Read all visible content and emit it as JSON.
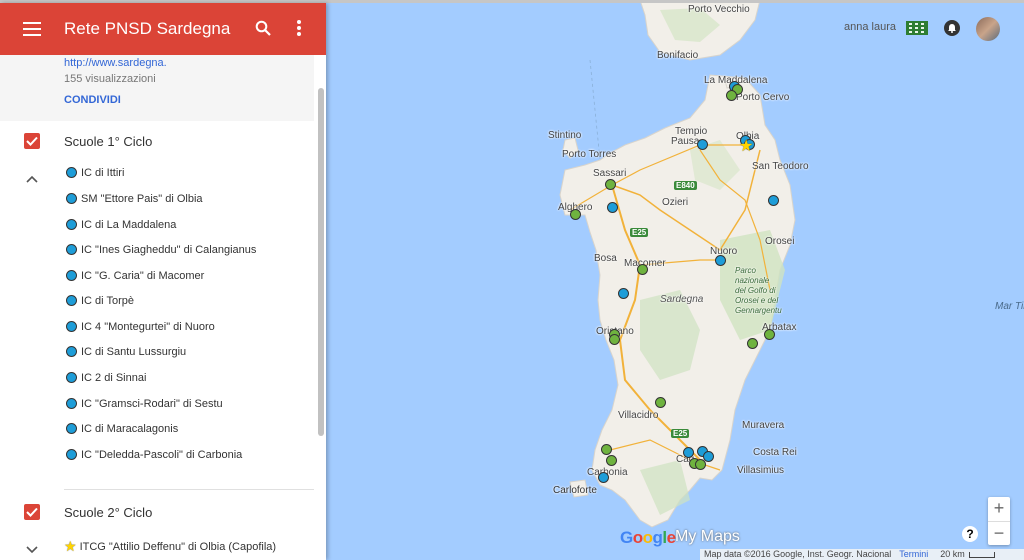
{
  "panel": {
    "app_title": "Rete PNSD Sardegna",
    "info": {
      "link": "http://www.sardegna.",
      "views": "155 visualizzazioni",
      "share": "CONDIVIDI"
    },
    "layers": [
      {
        "title": "Scuole 1° Ciclo",
        "checked": true,
        "expanded": true,
        "items": [
          {
            "label": "IC di Ittiri",
            "icon": "blue-circle"
          },
          {
            "label": "SM \"Ettore Pais\" di Olbia",
            "icon": "blue-circle"
          },
          {
            "label": "IC di La Maddalena",
            "icon": "blue-circle"
          },
          {
            "label": "IC \"Ines Giagheddu\" di Calangianus",
            "icon": "blue-circle"
          },
          {
            "label": "IC \"G. Caria\" di Macomer",
            "icon": "blue-circle"
          },
          {
            "label": "IC di Torpè",
            "icon": "blue-circle"
          },
          {
            "label": "IC 4 \"Montegurtei\" di Nuoro",
            "icon": "blue-circle"
          },
          {
            "label": "IC di Santu Lussurgiu",
            "icon": "blue-circle"
          },
          {
            "label": "IC 2 di Sinnai",
            "icon": "blue-circle"
          },
          {
            "label": "IC \"Gramsci-Rodari\" di Sestu",
            "icon": "blue-circle"
          },
          {
            "label": "IC di Maracalagonis",
            "icon": "blue-circle"
          },
          {
            "label": "IC \"Deledda-Pascoli\" di Carbonia",
            "icon": "blue-circle"
          }
        ]
      },
      {
        "title": "Scuole 2° Ciclo",
        "checked": true,
        "expanded": true,
        "items": [
          {
            "label": "ITCG \"Attilio Deffenu\" di Olbia (Capofila)",
            "icon": "yellow-star"
          }
        ]
      }
    ]
  },
  "header": {
    "user_name": "anna laura"
  },
  "map": {
    "labels": {
      "porto_vecchio": "Porto Vecchio",
      "bonifacio": "Bonifacio",
      "la_maddalena": "La Maddalena",
      "porto_cervo": "Porto Cervo",
      "stintino": "Stintino",
      "tempio": "Tempio",
      "pausania": "Pausa",
      "olbia": "Olbia",
      "porto_torres": "Porto Torres",
      "san_teodoro": "San Teodoro",
      "sassari": "Sassari",
      "alghero": "Alghero",
      "ozieri": "Ozieri",
      "nuoro": "Nuoro",
      "orosei": "Orosei",
      "bosa": "Bosa",
      "macomer": "Macomer",
      "parco": "Parco\nnazionale\ndel Golfo di\nOrosei e del\nGennargentu",
      "sardegna": "Sardegna",
      "mar_tirreno": "Mar Tir",
      "arbatax": "Arbatax",
      "oristano": "Oristano",
      "villacidro": "Villacidro",
      "muravera": "Muravera",
      "cagliari": "Cag",
      "carbonia": "Carbonia",
      "villasimius": "Villasimius",
      "costa_rei": "Costa Rei",
      "carloforte": "Carloforte",
      "e840": "E840",
      "e25_north": "E25",
      "e25_south": "E25"
    },
    "markers": [
      {
        "type": "blue",
        "place": "La Maddalena"
      },
      {
        "type": "green",
        "place": "La Maddalena"
      },
      {
        "type": "green",
        "place": "La Maddalena"
      },
      {
        "type": "blue",
        "place": "Tempio Pausania"
      },
      {
        "type": "blue",
        "place": "Olbia"
      },
      {
        "type": "blue",
        "place": "Olbia"
      },
      {
        "type": "star",
        "place": "Olbia"
      },
      {
        "type": "green",
        "place": "Sassari"
      },
      {
        "type": "blue",
        "place": "Ittiri"
      },
      {
        "type": "green",
        "place": "Alghero"
      },
      {
        "type": "blue",
        "place": "Torpè"
      },
      {
        "type": "blue",
        "place": "Nuoro"
      },
      {
        "type": "green",
        "place": "Macomer"
      },
      {
        "type": "blue",
        "place": "Santu Lussurgiu"
      },
      {
        "type": "green",
        "place": "Oristano"
      },
      {
        "type": "green",
        "place": "Oristano"
      },
      {
        "type": "green",
        "place": "Arbatax"
      },
      {
        "type": "green",
        "place": "Tortolì"
      },
      {
        "type": "green",
        "place": "Villacidro"
      },
      {
        "type": "green",
        "place": "Iglesias"
      },
      {
        "type": "green",
        "place": "Iglesias"
      },
      {
        "type": "blue",
        "place": "Carbonia"
      },
      {
        "type": "blue",
        "place": "Cagliari"
      },
      {
        "type": "blue",
        "place": "Cagliari"
      },
      {
        "type": "blue",
        "place": "Cagliari"
      },
      {
        "type": "green",
        "place": "Cagliari"
      },
      {
        "type": "green",
        "place": "Cagliari"
      }
    ],
    "footer": {
      "map_data": "Map data ©2016 Google, Inst. Geogr. Nacional",
      "terms": "Termini",
      "scale": "20 km"
    },
    "logo_google": "Google",
    "logo_mymaps": "My Maps",
    "zoom_in": "+",
    "zoom_out": "−",
    "help": "?"
  },
  "colors": {
    "header_red": "#db4437",
    "sea": "#a3ccff",
    "land": "#f2efe9",
    "marker_blue": "#1e9dd8",
    "marker_green": "#6fb33f",
    "star_yellow": "#ffd400",
    "link_blue": "#3367d6"
  }
}
